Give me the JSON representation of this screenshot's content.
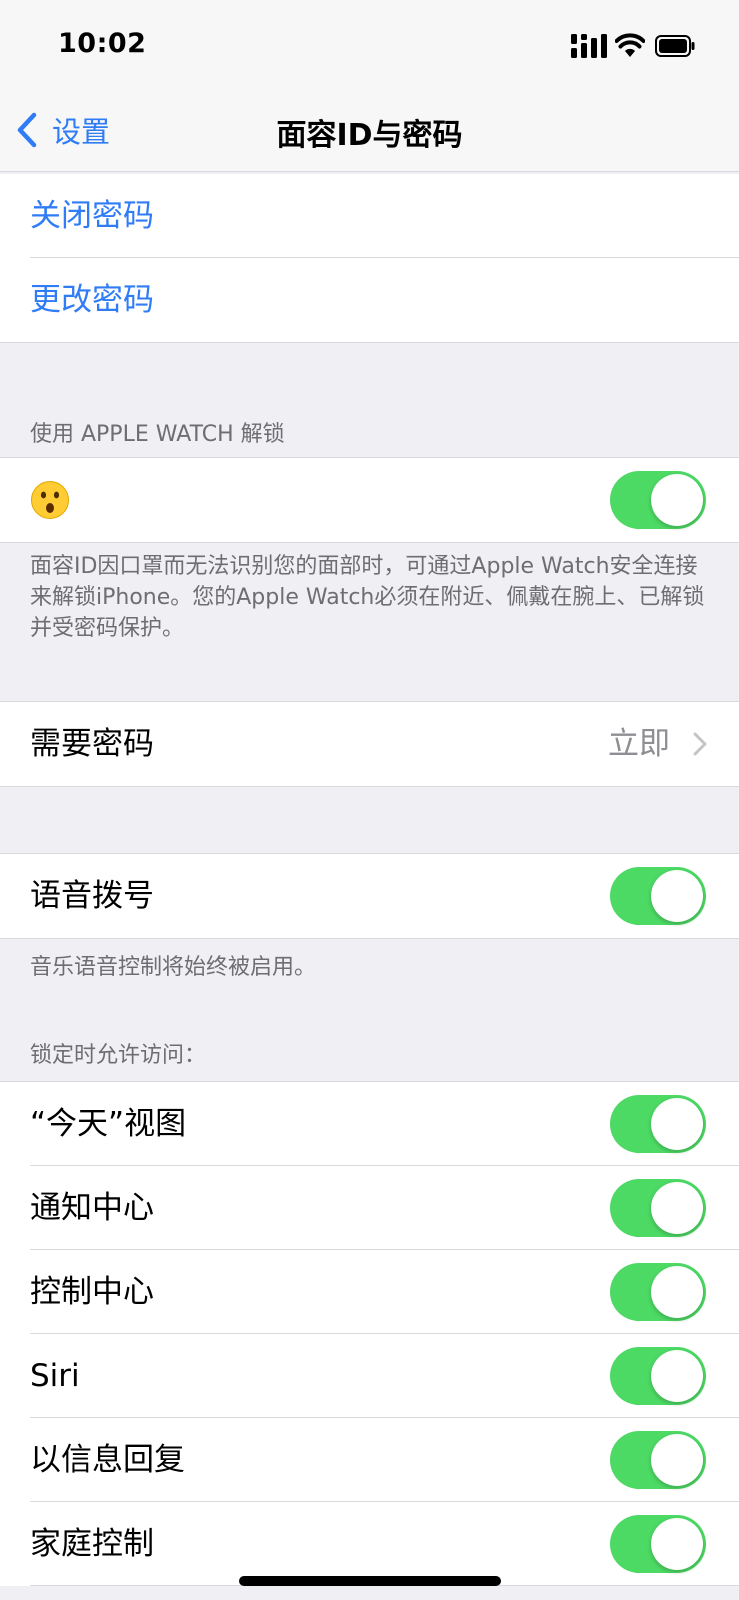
{
  "status_bar": {
    "time": "10:02"
  },
  "nav": {
    "back_label": "设置",
    "title": "面容ID与密码"
  },
  "passcode_actions": [
    {
      "label": "关闭密码"
    },
    {
      "label": "更改密码"
    }
  ],
  "apple_watch": {
    "header": "使用 APPLE WATCH 解锁",
    "device_emoji": "😮",
    "toggle_on": true,
    "footer": "面容ID因口罩而无法识别您的面部时，可通过Apple Watch安全连接来解锁iPhone。您的Apple Watch必须在附近、佩戴在腕上、已解锁并受密码保护。"
  },
  "require_passcode": {
    "label": "需要密码",
    "value": "立即"
  },
  "voice_dial": {
    "label": "语音拨号",
    "toggle_on": true,
    "footer": "音乐语音控制将始终被启用。"
  },
  "lock_access": {
    "header": "锁定时允许访问：",
    "items": [
      {
        "label": "“今天”视图",
        "on": true
      },
      {
        "label": "通知中心",
        "on": true
      },
      {
        "label": "控制中心",
        "on": true
      },
      {
        "label": "Siri",
        "on": true
      },
      {
        "label": "以信息回复",
        "on": true
      },
      {
        "label": "家庭控制",
        "on": true
      }
    ]
  },
  "colors": {
    "accent": "#2F7CF6",
    "toggle_on": "#4CD964",
    "background": "#EFEFF4"
  }
}
